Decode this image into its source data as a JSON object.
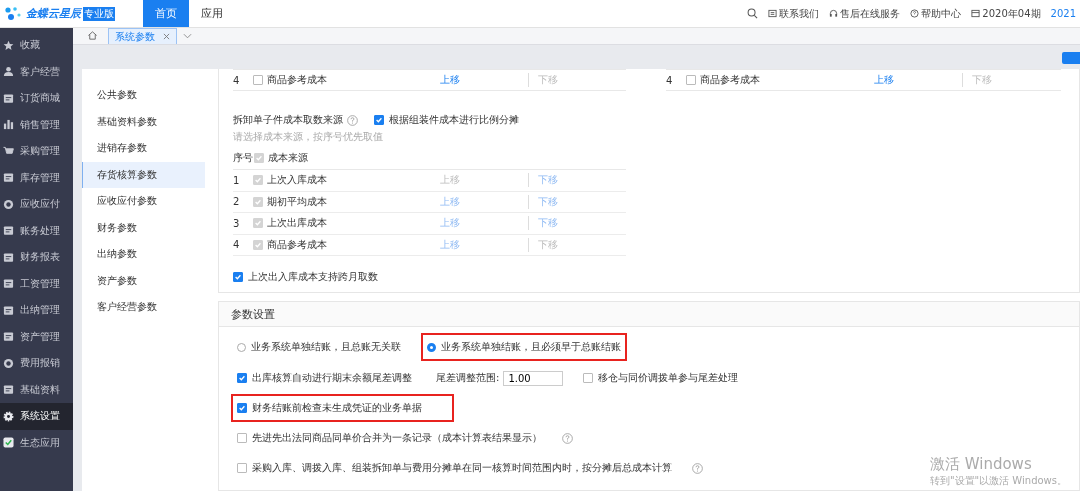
{
  "header": {
    "logo": "金蝶云星辰",
    "edition": "专业版",
    "nav": [
      {
        "label": "首页",
        "selected": true
      },
      {
        "label": "应用",
        "selected": false
      }
    ],
    "links": [
      "联系我们",
      "售后在线服务",
      "帮助中心"
    ],
    "period": "2020年04期",
    "year": "2021"
  },
  "tabs": [
    {
      "label": "系统参数",
      "selected": true
    }
  ],
  "sidebar": {
    "items": [
      {
        "label": "收藏",
        "selected": false
      },
      {
        "label": "客户经营",
        "selected": false
      },
      {
        "label": "订货商城",
        "selected": false
      },
      {
        "label": "销售管理",
        "selected": false
      },
      {
        "label": "采购管理",
        "selected": false
      },
      {
        "label": "库存管理",
        "selected": false
      },
      {
        "label": "应收应付",
        "selected": false
      },
      {
        "label": "账务处理",
        "selected": false
      },
      {
        "label": "财务报表",
        "selected": false
      },
      {
        "label": "工资管理",
        "selected": false
      },
      {
        "label": "出纳管理",
        "selected": false
      },
      {
        "label": "资产管理",
        "selected": false
      },
      {
        "label": "费用报销",
        "selected": false
      },
      {
        "label": "基础资料",
        "selected": false
      },
      {
        "label": "系统设置",
        "selected": true
      },
      {
        "label": "生态应用",
        "selected": false
      }
    ]
  },
  "settings_menu": [
    {
      "label": "公共参数",
      "selected": false
    },
    {
      "label": "基础资料参数",
      "selected": false
    },
    {
      "label": "进销存参数",
      "selected": false
    },
    {
      "label": "存货核算参数",
      "selected": true
    },
    {
      "label": "应收应付参数",
      "selected": false
    },
    {
      "label": "财务参数",
      "selected": false
    },
    {
      "label": "出纳参数",
      "selected": false
    },
    {
      "label": "资产参数",
      "selected": false
    },
    {
      "label": "客户经营参数",
      "selected": false
    }
  ],
  "top_rows": [
    {
      "index": "4",
      "checked": false,
      "label": "商品参考成本",
      "up": "上移",
      "down": "下移",
      "up_enabled": true,
      "down_enabled": false
    },
    {
      "index": "4",
      "checked": false,
      "label": "商品参考成本",
      "up": "上移",
      "down": "下移",
      "up_enabled": true,
      "down_enabled": false
    }
  ],
  "disassembly": {
    "title": "拆卸单子件成本取数来源",
    "option": {
      "label": "根据组装件成本进行比例分摊",
      "checked": true
    },
    "hint": "请选择成本来源，按序号优先取值",
    "columns": [
      "序号",
      "成本来源"
    ],
    "header_checked": true,
    "disabled": true,
    "rows": [
      {
        "index": "1",
        "checked": true,
        "label": "上次入库成本",
        "up": "上移",
        "down": "下移",
        "up_enabled": false,
        "down_enabled": true
      },
      {
        "index": "2",
        "checked": true,
        "label": "期初平均成本",
        "up": "上移",
        "down": "下移",
        "up_enabled": true,
        "down_enabled": true
      },
      {
        "index": "3",
        "checked": true,
        "label": "上次出库成本",
        "up": "上移",
        "down": "下移",
        "up_enabled": true,
        "down_enabled": true
      },
      {
        "index": "4",
        "checked": true,
        "label": "商品参考成本",
        "up": "上移",
        "down": "下移",
        "up_enabled": true,
        "down_enabled": false
      }
    ]
  },
  "cross_month": {
    "label": "上次出入库成本支持跨月取数",
    "checked": true
  },
  "params": {
    "title": "参数设置",
    "radios": [
      {
        "label": "业务系统单独结账，且总账无关联",
        "selected": false,
        "highlighted": false
      },
      {
        "label": "业务系统单独结账，且必须早于总账结账",
        "selected": true,
        "highlighted": true
      }
    ],
    "options": [
      {
        "label": "出库核算自动进行期末余额尾差调整",
        "checked": true,
        "highlighted": false,
        "range_label": "尾差调整范围:",
        "range_value": "1.00",
        "extra": {
          "label": "移仓与同价调拨单参与尾差处理",
          "checked": false
        }
      },
      {
        "label": "财务结账前检查未生成凭证的业务单据",
        "checked": true,
        "highlighted": true
      },
      {
        "label": "先进先出法同商品同单价合并为一条记录（成本计算表结果显示）",
        "checked": false,
        "highlighted": false,
        "help": true
      },
      {
        "label": "采购入库、调拨入库、组装拆卸单与费用分摊单在同一核算时间范围内时，按分摊后总成本计算",
        "checked": false,
        "highlighted": false,
        "help": true
      }
    ]
  },
  "os_notice": {
    "title": "激活 Windows",
    "text": "转到\"设置\"以激活 Windows。"
  }
}
